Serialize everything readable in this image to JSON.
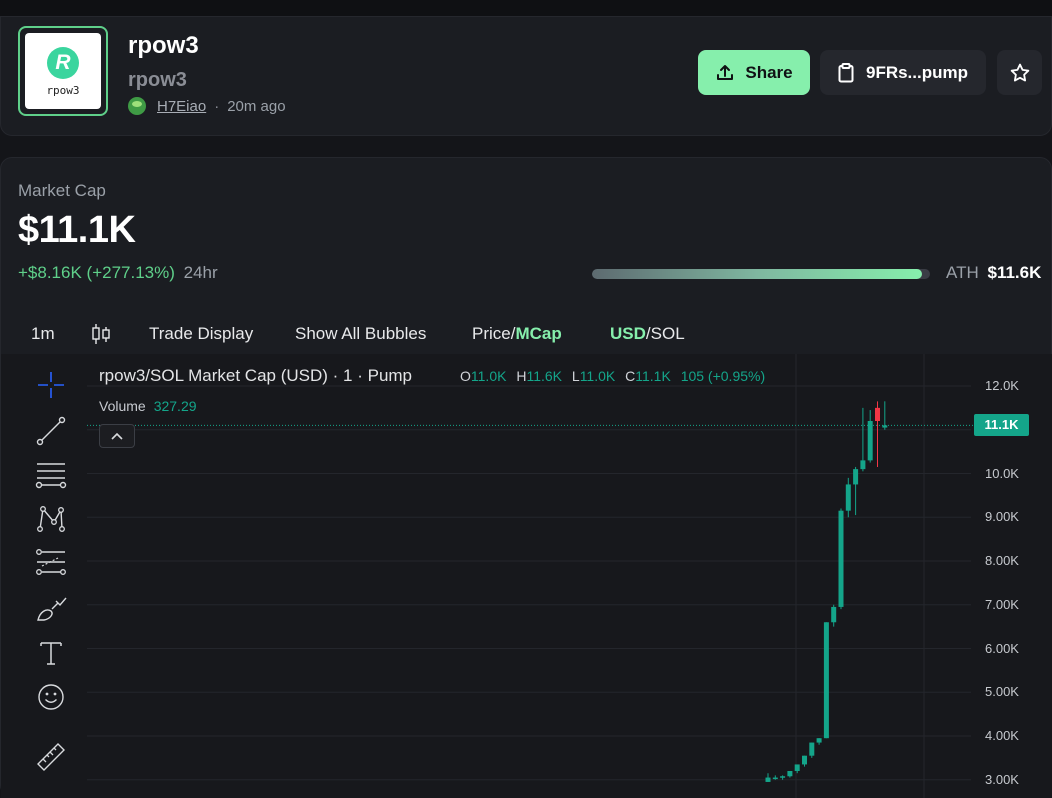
{
  "token": {
    "name": "rpow3",
    "symbol": "rpow3",
    "logo_text": "rpow3",
    "logo_glyph": "R",
    "creator": "H7Eiao",
    "age": "20m ago",
    "separator": "·"
  },
  "actions": {
    "share_label": "Share",
    "address_label": "9FRs...pump"
  },
  "market": {
    "label": "Market Cap",
    "value": "$11.1K",
    "change": "+$8.16K (+277.13%)",
    "change_period": "24hr",
    "ath_label": "ATH",
    "ath_value": "$11.6K",
    "ath_progress": 0.975
  },
  "toolbar": {
    "interval": "1m",
    "trade_display": "Trade Display",
    "show_bubbles": "Show All Bubbles",
    "price_label": "Price/",
    "mcap_label": "MCap",
    "usd_label": "USD",
    "sol_label": "/SOL"
  },
  "chart_header": {
    "title": "rpow3/SOL Market Cap (USD) · 1 · Pump",
    "o_key": "O",
    "o_val": "11.0K",
    "h_key": "H",
    "h_val": "11.6K",
    "l_key": "L",
    "l_val": "11.0K",
    "c_key": "C",
    "c_val": "11.1K",
    "change": "105 (+0.95%)",
    "volume_label": "Volume",
    "volume_value": "327.29"
  },
  "chart_data": {
    "type": "candlestick",
    "y_axis_labels": [
      "12.0K",
      "11.0K",
      "10.0K",
      "9.00K",
      "8.00K",
      "7.00K",
      "6.00K",
      "5.00K",
      "4.00K",
      "3.00K"
    ],
    "y_axis_values": [
      12000,
      11000,
      10000,
      9000,
      8000,
      7000,
      6000,
      5000,
      4000,
      3000
    ],
    "current_price_label": "11.1K",
    "current_price": 11100,
    "candles": [
      {
        "o": 2950,
        "h": 3150,
        "l": 2950,
        "c": 3050,
        "dir": "up"
      },
      {
        "o": 3050,
        "h": 3100,
        "l": 3000,
        "c": 3050,
        "dir": "up"
      },
      {
        "o": 3050,
        "h": 3100,
        "l": 3000,
        "c": 3080,
        "dir": "up"
      },
      {
        "o": 3080,
        "h": 3200,
        "l": 3050,
        "c": 3200,
        "dir": "up"
      },
      {
        "o": 3200,
        "h": 3300,
        "l": 3150,
        "c": 3350,
        "dir": "up"
      },
      {
        "o": 3350,
        "h": 3550,
        "l": 3300,
        "c": 3550,
        "dir": "up"
      },
      {
        "o": 3550,
        "h": 3850,
        "l": 3500,
        "c": 3850,
        "dir": "up"
      },
      {
        "o": 3850,
        "h": 3950,
        "l": 3800,
        "c": 3950,
        "dir": "up"
      },
      {
        "o": 3950,
        "h": 6600,
        "l": 3950,
        "c": 6600,
        "dir": "up"
      },
      {
        "o": 6600,
        "h": 7000,
        "l": 6500,
        "c": 6950,
        "dir": "up"
      },
      {
        "o": 6950,
        "h": 9200,
        "l": 6900,
        "c": 9150,
        "dir": "up"
      },
      {
        "o": 9150,
        "h": 9900,
        "l": 9000,
        "c": 9750,
        "dir": "up"
      },
      {
        "o": 9750,
        "h": 10150,
        "l": 9050,
        "c": 10100,
        "dir": "up"
      },
      {
        "o": 10100,
        "h": 11500,
        "l": 10050,
        "c": 10300,
        "dir": "up"
      },
      {
        "o": 10300,
        "h": 11450,
        "l": 10250,
        "c": 11200,
        "dir": "up"
      },
      {
        "o": 11500,
        "h": 11650,
        "l": 10150,
        "c": 11200,
        "dir": "down"
      },
      {
        "o": 11050,
        "h": 11650,
        "l": 11000,
        "c": 11100,
        "dir": "up"
      }
    ]
  },
  "colors": {
    "up": "#14a58a",
    "down": "#f23645",
    "accent": "#86efac"
  }
}
